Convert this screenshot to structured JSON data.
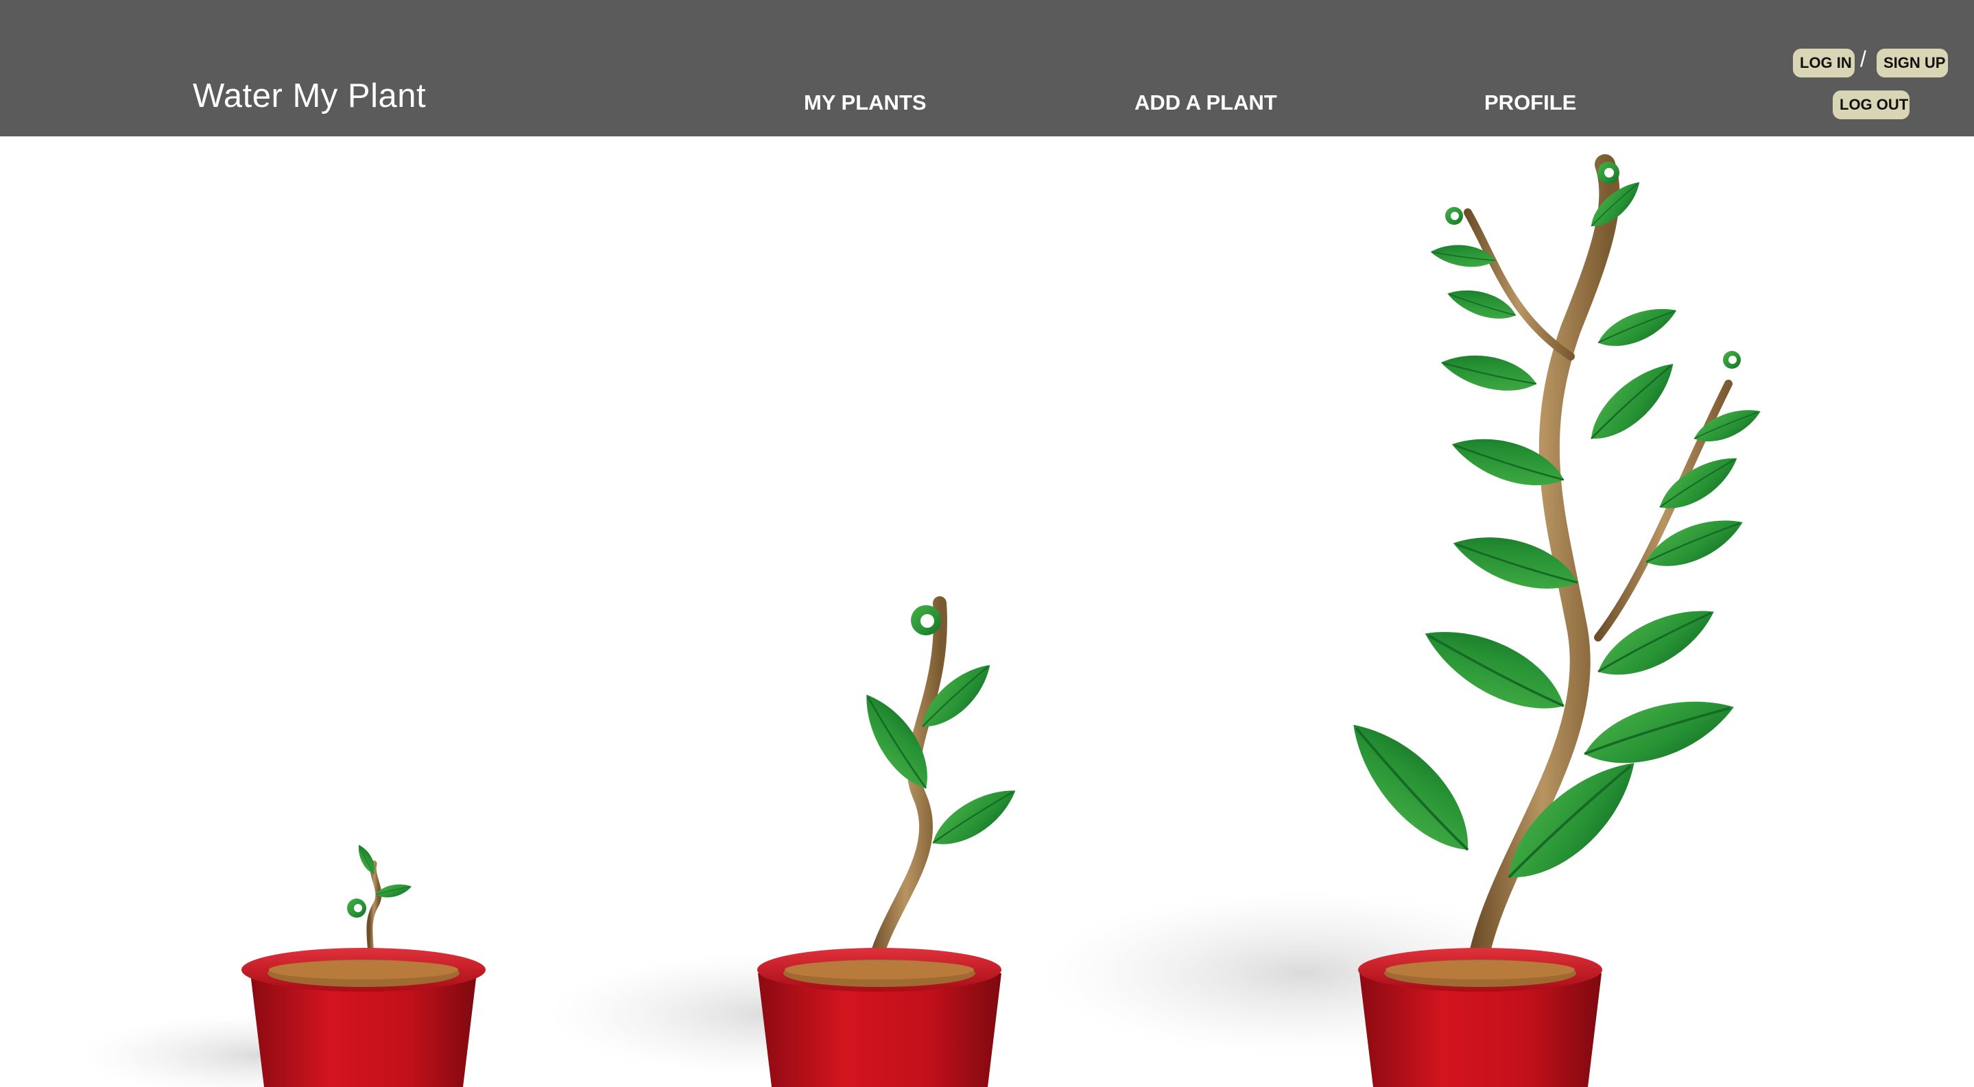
{
  "brand": {
    "title": "Water My Plant"
  },
  "nav": {
    "my_plants": "MY PLANTS",
    "add_plant": "ADD A PLANT",
    "profile": "PROFILE"
  },
  "auth": {
    "login": "LOG IN",
    "separator": "/",
    "signup": "SIGN UP",
    "logout": "LOG OUT"
  },
  "hero": {
    "image": "three potted plants at increasing growth stages",
    "colors": {
      "header_bg": "#5b5b5b",
      "button_bg": "#d9d6b5",
      "pot_red": "#c0101a",
      "leaf_green": "#2f9a3a",
      "stem_brown": "#a9824f"
    }
  }
}
